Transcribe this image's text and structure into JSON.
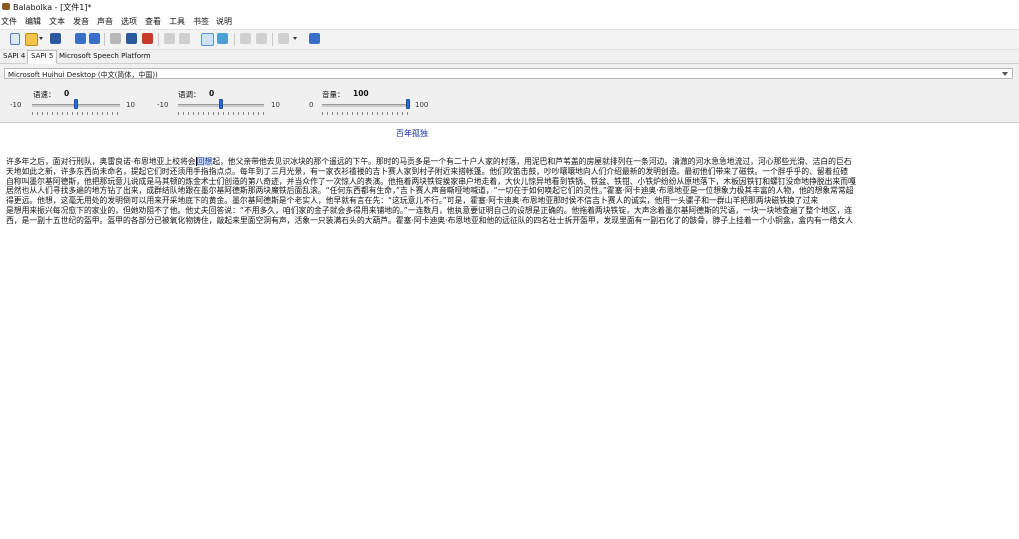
{
  "window": {
    "title": "Balabolka - [文件1]*"
  },
  "menu": [
    "文件",
    "编辑",
    "文本",
    "发音",
    "声音",
    "选项",
    "查看",
    "工具",
    "书签",
    "说明"
  ],
  "tabs": [
    "SAPI 4",
    "SAPI 5",
    "Microsoft Speech Platform"
  ],
  "voice": {
    "selected": "Microsoft Huihui Desktop (中文(简体，中国))"
  },
  "sliders": {
    "rate": {
      "label": "语速：",
      "value": "0",
      "min": "-10",
      "max": "10",
      "level": 0.5
    },
    "pitch": {
      "label": "语调：",
      "value": "0",
      "min": "-10",
      "max": "10",
      "level": 0.5
    },
    "volume": {
      "label": "音量：",
      "value": "100",
      "min": "0",
      "max": "100",
      "level": 1.0
    }
  },
  "document": {
    "heading": "百年孤独",
    "line1_a": "许多年之后，面对行刑队，奥雷良诺·布恩地亚上校将会",
    "line1_hl": "回想",
    "line1_b": "起，他父亲带他去见识冰块的那个遥远的下午。那时的马贡多是一个有二十户人家的村落，用泥巴和芦苇盖的房屋就排列在一条河边。清澈的河水急急地流过，河心那些光滑、洁白的巨石",
    "lines": [
      "天地如此之新，许多东西尚未命名，提起它们时还须用手指指点点。每年到了三月光景，有一家衣衫褴褛的吉卜赛人家到村子附近来搭帐篷。他们吹笛击鼓，吵吵嚷嚷地向人们介绍最新的发明创造。最初他们带来了磁铁。一个胖乎乎的、留着拉碴",
      "自称叫墨尔基阿德斯，他把那玩意儿说成是马其顿的炼金术士们创造的第八奇迹，并当众作了一次惊人的表演。他拖着两块铁锭挨家串户地走着，大伙儿惊异地看到铁锅、铁盆、铁钳、小铁炉纷纷从原地落下，木板因铁钉和螺钉没命地挣脱出来而嘎",
      "居然也从人们寻找多遍的地方钻了出来，成群结队地跟在墨尔基阿德斯那两块魔铁后面乱滚。“任何东西都有生命，”吉卜赛人声音嘶哑地喊道，“一切在于如何唤起它们的灵性。”霍塞·阿卡迪奥·布恩地亚是一位想象力极其丰富的人物，他的想象常常超",
      "得更远。他想，这毫无用处的发明倒可以用来开采地底下的黄金。墨尔基阿德斯是个老实人，他早就有言在先：“这玩意儿不行。”可是，霍塞·阿卡迪奥·布恩地亚那时侯不信吉卜赛人的诚实，他用一头骡子和一群山羊把那两块磁铁换了过来",
      "是想用来振兴每况愈下的家业的，但她劝阻不了他。他丈夫回答说：“不用多久，咱们家的金子就会多得用来铺地的。”一连数月，他执意要证明自己的设想是正确的。他拖着两块铁锭，大声念着墨尔基阿德斯的咒语，一块一块地查遍了整个地区，连",
      "西，是一副十五世纪的盔甲。盔甲的各部分已被氧化物铸住，敲起来里面空洞有声，活象一只装满石头的大葫芦。霍塞·阿卡迪奥·布恩地亚和他的远征队的四名壮士拆开盔甲，发现里面有一副石化了的骸骨，脖子上挂着一个小铜盒，盒内有一绺女人"
    ]
  }
}
